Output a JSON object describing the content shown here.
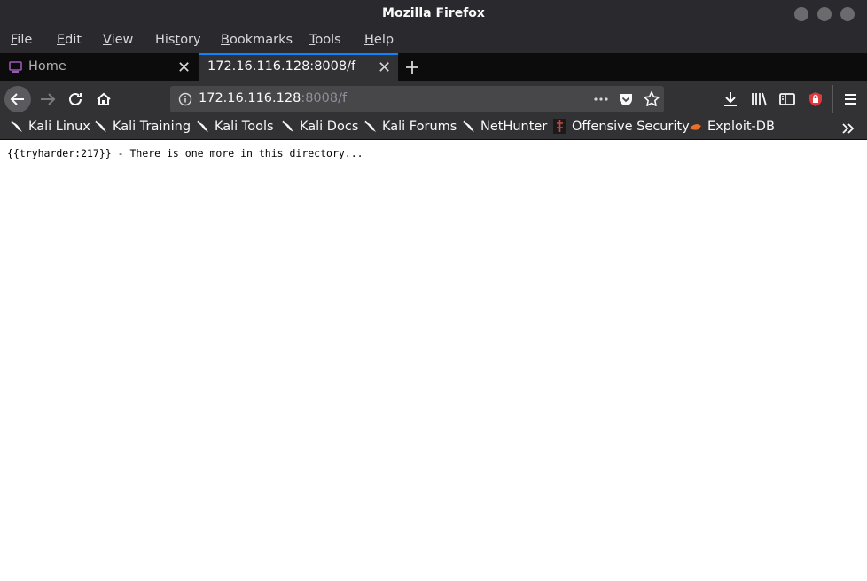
{
  "window": {
    "title": "Mozilla Firefox"
  },
  "menu": {
    "file": "File",
    "edit": "Edit",
    "view": "View",
    "history": "History",
    "bookmarks": "Bookmarks",
    "tools": "Tools",
    "help": "Help"
  },
  "tabs": [
    {
      "label": "Home"
    },
    {
      "label": "172.16.116.128:8008/f"
    }
  ],
  "address": {
    "host": "172.16.116.128",
    "rest": ":8008/f"
  },
  "bookmarks": [
    {
      "label": "Kali Linux"
    },
    {
      "label": "Kali Training"
    },
    {
      "label": "Kali Tools"
    },
    {
      "label": "Kali Docs"
    },
    {
      "label": "Kali Forums"
    },
    {
      "label": "NetHunter"
    },
    {
      "label": "Offensive Security"
    },
    {
      "label": "Exploit-DB"
    }
  ],
  "page": {
    "text": "{{tryharder:217}} - There is one more in this directory..."
  },
  "colors": {
    "accent": "#0a84ff",
    "chrome": "#323234",
    "tabstrip": "#0c0c0d",
    "titlebar": "#2a2a2e"
  },
  "icons": [
    "back-arrow-icon",
    "forward-arrow-icon",
    "reload-icon",
    "home-icon",
    "info-icon",
    "more-dots-icon",
    "pocket-icon",
    "star-icon",
    "download-icon",
    "library-icon",
    "sidebar-icon",
    "extension-icon",
    "hamburger-menu-icon",
    "kali-dragon-icon",
    "offsec-icon",
    "exploitdb-icon",
    "overflow-chevron-icon",
    "new-tab-plus-icon",
    "close-icon"
  ]
}
